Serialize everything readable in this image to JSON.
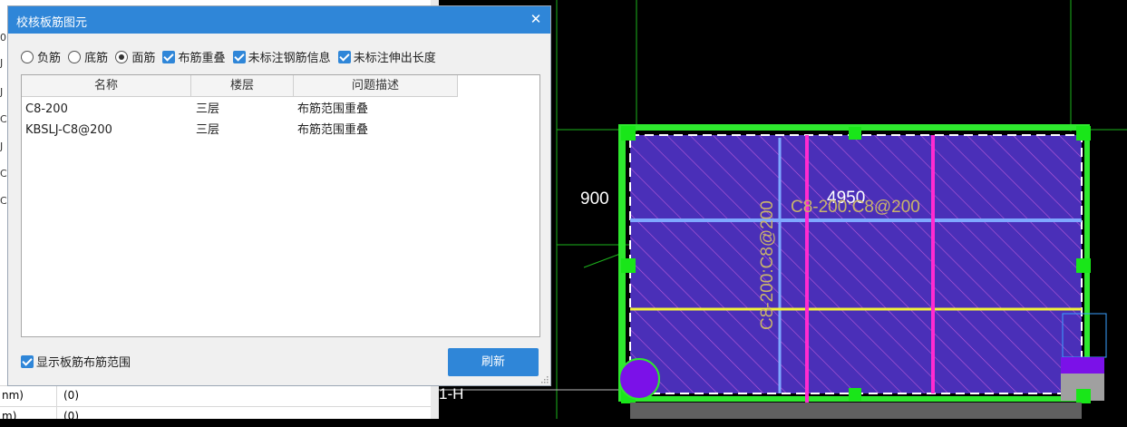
{
  "dialog": {
    "title": "校核板筋图元",
    "close_label": "✕",
    "options": {
      "radios": [
        {
          "label": "负筋",
          "selected": false
        },
        {
          "label": "底筋",
          "selected": false
        },
        {
          "label": "面筋",
          "selected": true
        }
      ],
      "checkboxes": [
        {
          "label": "布筋重叠",
          "checked": true
        },
        {
          "label": "未标注钢筋信息",
          "checked": true
        },
        {
          "label": "未标注伸出长度",
          "checked": true
        }
      ]
    },
    "table": {
      "columns": [
        "名称",
        "楼层",
        "问题描述"
      ],
      "rows": [
        {
          "name": "C8-200",
          "floor": "三层",
          "desc": "布筋范围重叠"
        },
        {
          "name": "KBSLJ-C8@200",
          "floor": "三层",
          "desc": "布筋范围重叠"
        }
      ]
    },
    "show_range_label": "显示板筋布筋范围",
    "show_range_checked": true,
    "refresh_label": "刷新"
  },
  "property_panel": {
    "rows": [
      {
        "key": "nm)",
        "value": "(0)"
      },
      {
        "key": "m)",
        "value": "(0)"
      }
    ]
  },
  "cad": {
    "dim_900": "900",
    "dim_4950": "4950",
    "label_horizontal": "C8-200:C8@200",
    "label_vertical": "C8-200:C8@200",
    "axis_label": "1-H",
    "colors": {
      "background": "#000000",
      "slab_fill": "#4a2fb8",
      "slab_border": "#2ee82e",
      "rebar_pink": "#ff2ad0",
      "rebar_yellow": "#f2f23a",
      "rebar_blue": "#7fa8ff",
      "label_color": "#c9b46a",
      "title_bar": "#2f86d8"
    }
  }
}
